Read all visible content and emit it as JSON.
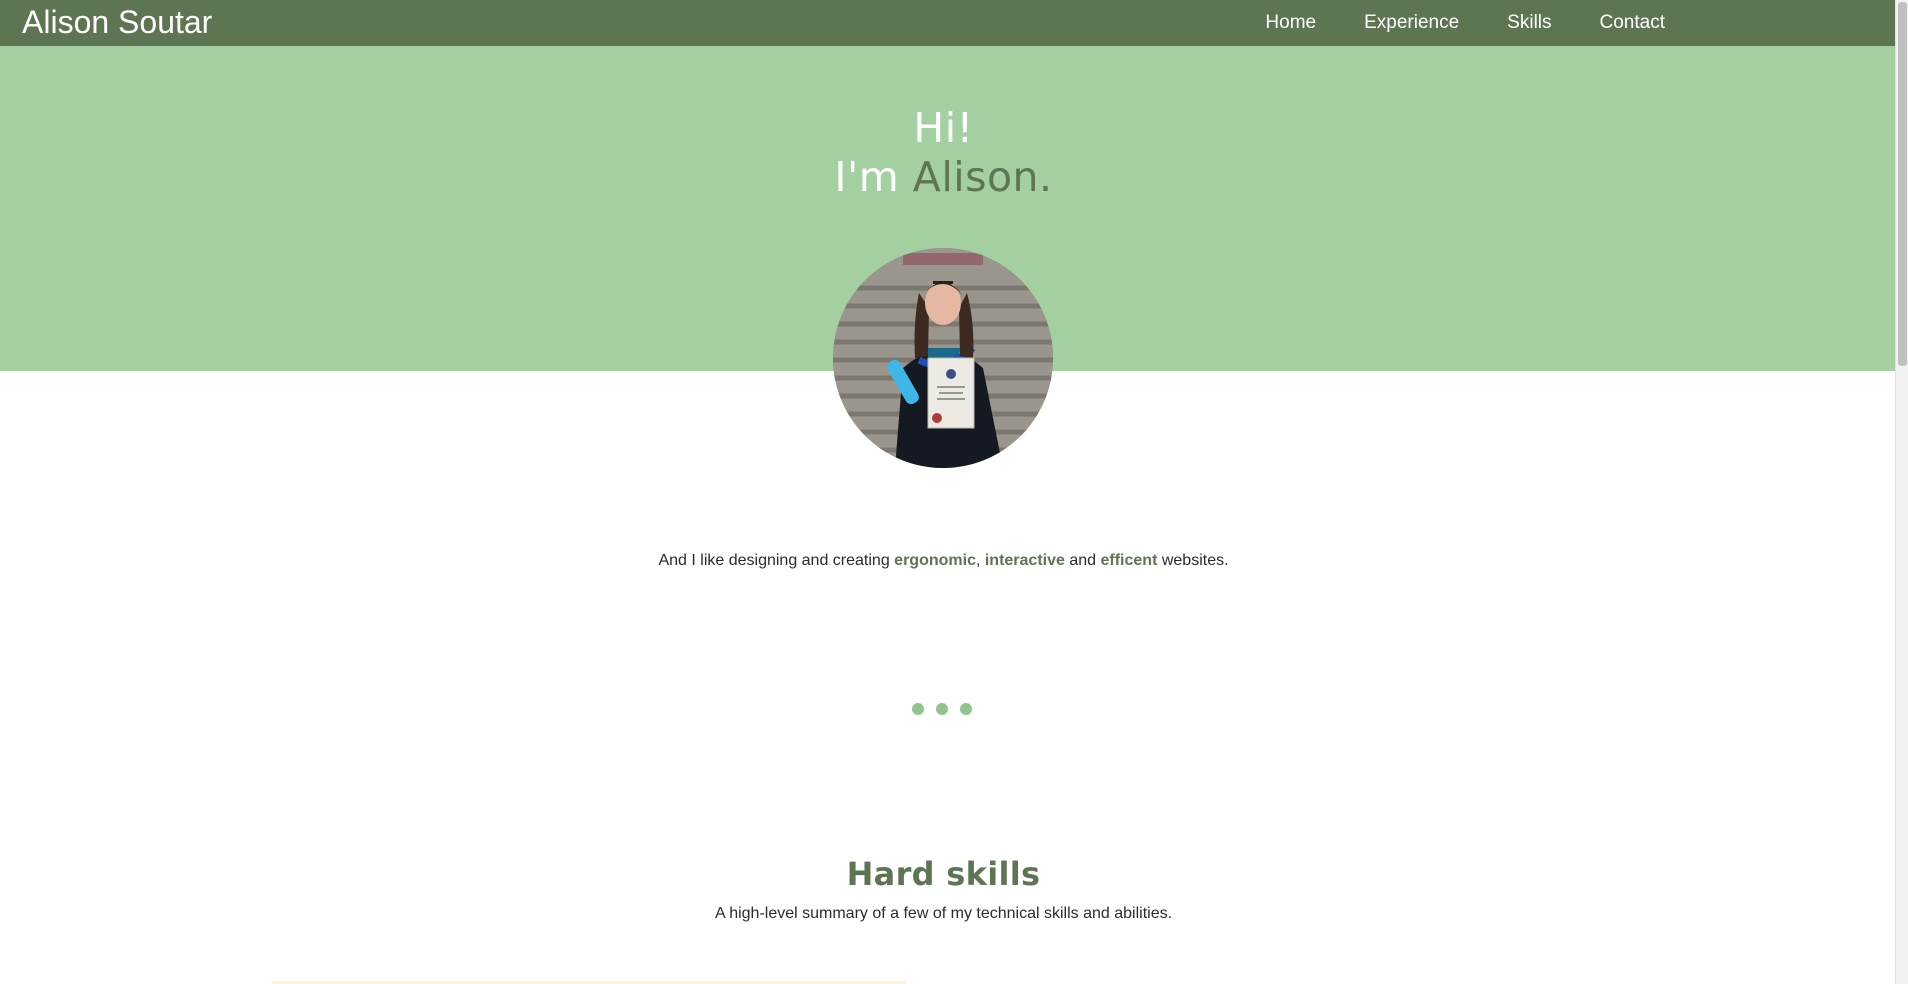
{
  "navbar": {
    "brand": "Alison Soutar",
    "links": [
      "Home",
      "Experience",
      "Skills",
      "Contact"
    ]
  },
  "hero": {
    "greeting": "Hi!",
    "intro_prefix": "I'm ",
    "intro_name": "Alison."
  },
  "avatar": {
    "alt": "Graduation photo of Alison holding a diploma"
  },
  "tagline": {
    "part1": "And I like designing and creating ",
    "word1": "ergonomic",
    "sep1": ", ",
    "word2": "interactive",
    "sep2": " and ",
    "word3": "efficent",
    "part_end": " websites."
  },
  "skills": {
    "title": "Hard skills",
    "subtitle": "A high-level summary of a few of my technical skills and abilities."
  },
  "colors": {
    "nav_bg": "#5e7553",
    "hero_bg": "#a4d0a1",
    "accent": "#5e7553",
    "dots": "#8fc48c"
  }
}
